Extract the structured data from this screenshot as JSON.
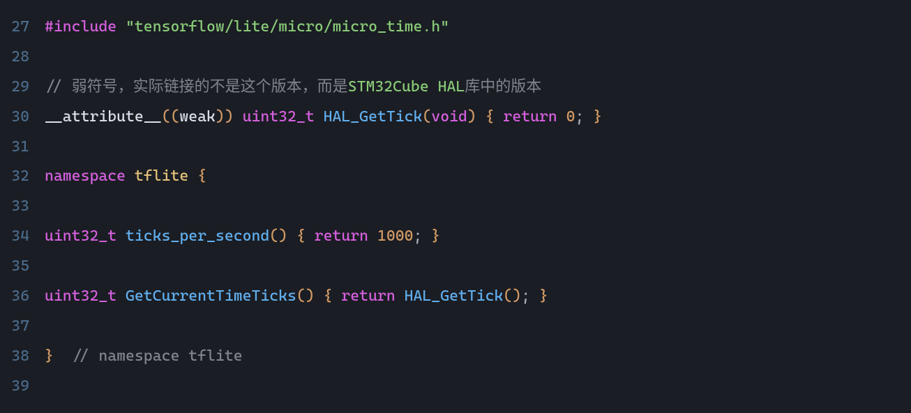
{
  "editor": {
    "lines": [
      {
        "num": "27",
        "tokens": [
          {
            "cls": "tok-include",
            "t": "#include"
          },
          {
            "cls": "tok-plain",
            "t": " "
          },
          {
            "cls": "tok-string",
            "t": "\"tensorflow/lite/micro/micro_time.h\""
          }
        ]
      },
      {
        "num": "28",
        "tokens": []
      },
      {
        "num": "29",
        "tokens": [
          {
            "cls": "tok-comment",
            "t": "// "
          },
          {
            "cls": "tok-cjk",
            "t": "弱符号，实际链接的不是这个版本，而是"
          },
          {
            "cls": "tok-cjk-hl",
            "t": "STM32Cube HAL"
          },
          {
            "cls": "tok-cjk",
            "t": "库中的版本"
          }
        ]
      },
      {
        "num": "30",
        "tokens": [
          {
            "cls": "tok-plain",
            "t": "__attribute__"
          },
          {
            "cls": "tok-paren",
            "t": "(("
          },
          {
            "cls": "tok-plain",
            "t": "weak"
          },
          {
            "cls": "tok-paren",
            "t": "))"
          },
          {
            "cls": "tok-plain",
            "t": " "
          },
          {
            "cls": "tok-type",
            "t": "uint32_t"
          },
          {
            "cls": "tok-plain",
            "t": " "
          },
          {
            "cls": "tok-func",
            "t": "HAL_GetTick"
          },
          {
            "cls": "tok-paren",
            "t": "("
          },
          {
            "cls": "tok-type",
            "t": "void"
          },
          {
            "cls": "tok-paren",
            "t": ")"
          },
          {
            "cls": "tok-plain",
            "t": " "
          },
          {
            "cls": "tok-brace",
            "t": "{"
          },
          {
            "cls": "tok-plain",
            "t": " "
          },
          {
            "cls": "tok-keyword",
            "t": "return"
          },
          {
            "cls": "tok-plain",
            "t": " "
          },
          {
            "cls": "tok-number",
            "t": "0"
          },
          {
            "cls": "tok-semi",
            "t": ";"
          },
          {
            "cls": "tok-plain",
            "t": " "
          },
          {
            "cls": "tok-brace",
            "t": "}"
          }
        ]
      },
      {
        "num": "31",
        "tokens": []
      },
      {
        "num": "32",
        "tokens": [
          {
            "cls": "tok-keyword",
            "t": "namespace"
          },
          {
            "cls": "tok-plain",
            "t": " "
          },
          {
            "cls": "tok-ident",
            "t": "tflite"
          },
          {
            "cls": "tok-plain",
            "t": " "
          },
          {
            "cls": "tok-brace",
            "t": "{"
          }
        ]
      },
      {
        "num": "33",
        "tokens": []
      },
      {
        "num": "34",
        "tokens": [
          {
            "cls": "tok-type",
            "t": "uint32_t"
          },
          {
            "cls": "tok-plain",
            "t": " "
          },
          {
            "cls": "tok-func",
            "t": "ticks_per_second"
          },
          {
            "cls": "tok-paren",
            "t": "()"
          },
          {
            "cls": "tok-plain",
            "t": " "
          },
          {
            "cls": "tok-brace",
            "t": "{"
          },
          {
            "cls": "tok-plain",
            "t": " "
          },
          {
            "cls": "tok-keyword",
            "t": "return"
          },
          {
            "cls": "tok-plain",
            "t": " "
          },
          {
            "cls": "tok-number",
            "t": "1000"
          },
          {
            "cls": "tok-semi",
            "t": ";"
          },
          {
            "cls": "tok-plain",
            "t": " "
          },
          {
            "cls": "tok-brace",
            "t": "}"
          }
        ]
      },
      {
        "num": "35",
        "tokens": []
      },
      {
        "num": "36",
        "tokens": [
          {
            "cls": "tok-type",
            "t": "uint32_t"
          },
          {
            "cls": "tok-plain",
            "t": " "
          },
          {
            "cls": "tok-func",
            "t": "GetCurrentTimeTicks"
          },
          {
            "cls": "tok-paren",
            "t": "()"
          },
          {
            "cls": "tok-plain",
            "t": " "
          },
          {
            "cls": "tok-brace",
            "t": "{"
          },
          {
            "cls": "tok-plain",
            "t": " "
          },
          {
            "cls": "tok-keyword",
            "t": "return"
          },
          {
            "cls": "tok-plain",
            "t": " "
          },
          {
            "cls": "tok-func",
            "t": "HAL_GetTick"
          },
          {
            "cls": "tok-paren",
            "t": "()"
          },
          {
            "cls": "tok-semi",
            "t": ";"
          },
          {
            "cls": "tok-plain",
            "t": " "
          },
          {
            "cls": "tok-brace",
            "t": "}"
          }
        ]
      },
      {
        "num": "37",
        "tokens": []
      },
      {
        "num": "38",
        "tokens": [
          {
            "cls": "tok-brace",
            "t": "}"
          },
          {
            "cls": "tok-plain",
            "t": "  "
          },
          {
            "cls": "tok-comment",
            "t": "// namespace tflite"
          }
        ]
      },
      {
        "num": "39",
        "tokens": []
      }
    ]
  }
}
